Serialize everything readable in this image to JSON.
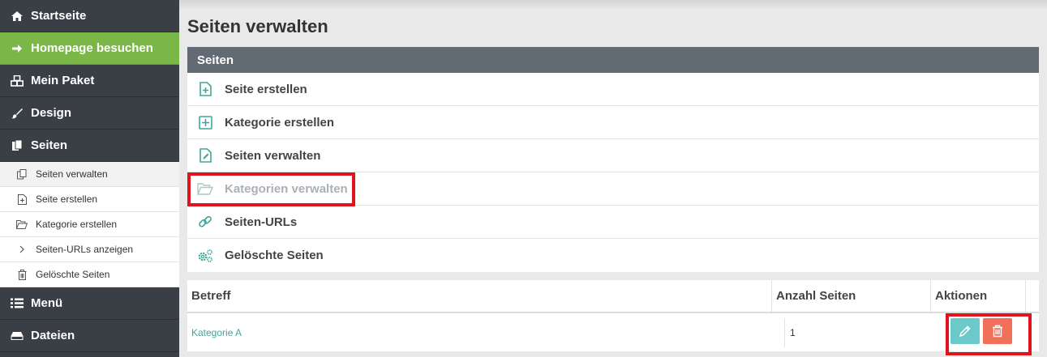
{
  "sidebar": {
    "items": [
      {
        "label": "Startseite",
        "icon": "home-icon"
      },
      {
        "label": "Homepage besuchen",
        "icon": "arrow-right-icon"
      },
      {
        "label": "Mein Paket",
        "icon": "cubes-icon"
      },
      {
        "label": "Design",
        "icon": "brush-icon"
      },
      {
        "label": "Seiten",
        "icon": "files-icon"
      }
    ],
    "sub_items": [
      {
        "label": "Seiten verwalten",
        "icon": "copy-icon"
      },
      {
        "label": "Seite erstellen",
        "icon": "file-plus-icon"
      },
      {
        "label": "Kategorie erstellen",
        "icon": "folder-open-icon"
      },
      {
        "label": "Seiten-URLs anzeigen",
        "icon": "chevron-right-icon"
      },
      {
        "label": "Gelöschte Seiten",
        "icon": "trash-icon"
      }
    ],
    "bottom_items": [
      {
        "label": "Menü",
        "icon": "list-icon"
      },
      {
        "label": "Dateien",
        "icon": "drive-icon"
      }
    ]
  },
  "page": {
    "title": "Seiten verwalten"
  },
  "panel": {
    "header": "Seiten",
    "items": [
      {
        "label": "Seite erstellen",
        "icon": "file-plus-icon"
      },
      {
        "label": "Kategorie erstellen",
        "icon": "square-plus-icon"
      },
      {
        "label": "Seiten verwalten",
        "icon": "file-edit-icon"
      },
      {
        "label": "Kategorien verwalten",
        "icon": "folder-open-icon"
      },
      {
        "label": "Seiten-URLs",
        "icon": "link-icon"
      },
      {
        "label": "Gelöschte Seiten",
        "icon": "gears-icon"
      }
    ]
  },
  "table": {
    "headers": [
      "Betreff",
      "Anzahl Seiten",
      "Aktionen"
    ],
    "rows": [
      {
        "betreff": "Kategorie A",
        "anzahl": "1"
      }
    ]
  },
  "colors": {
    "accent": "#3fa79a",
    "highlight": "#e0141e",
    "sidebar_bg": "#3a3f46",
    "green": "#7ab648",
    "edit": "#6cc9c9",
    "delete": "#f0705a"
  }
}
